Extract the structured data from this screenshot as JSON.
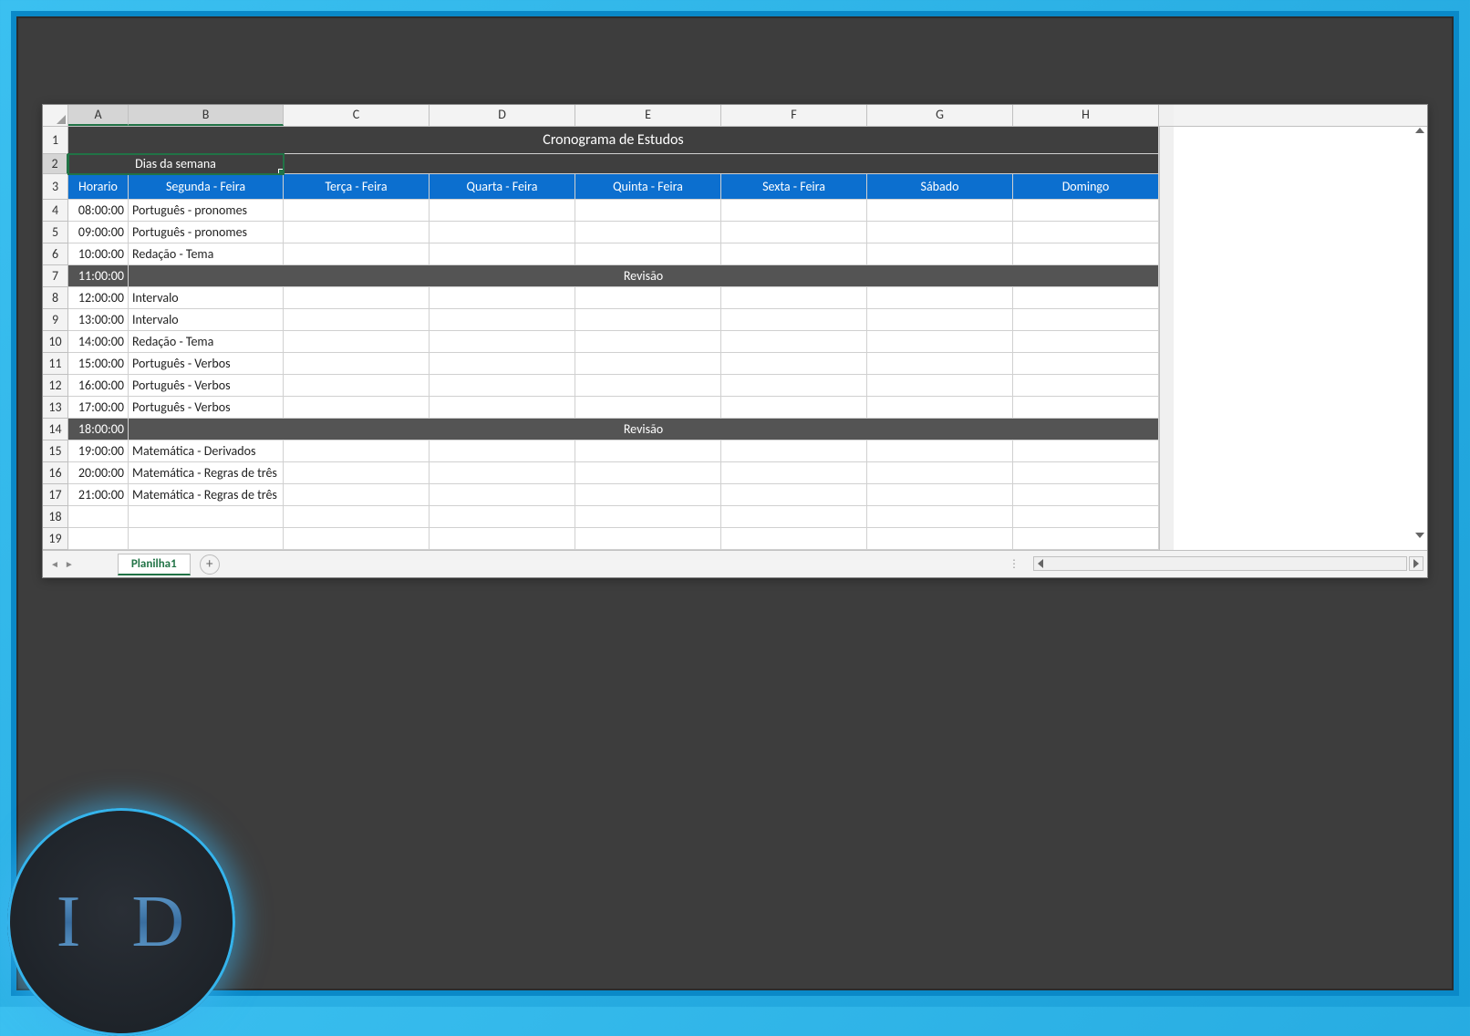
{
  "logo_text": "I D",
  "sheet": {
    "columns": [
      "A",
      "B",
      "C",
      "D",
      "E",
      "F",
      "G",
      "H"
    ],
    "title": "Cronograma de Estudos",
    "subheader": "Dias da semana",
    "day_headers": {
      "horario": "Horario",
      "segunda": "Segunda - Feira",
      "terca": "Terça  - Feira",
      "quarta": "Quarta - Feira",
      "quinta": "Quinta - Feira",
      "sexta": "Sexta - Feira",
      "sabado": "Sábado",
      "domingo": "Domingo"
    },
    "rows": [
      {
        "n": 4,
        "time": "08:00:00",
        "b": "Português - pronomes"
      },
      {
        "n": 5,
        "time": "09:00:00",
        "b": "Português - pronomes"
      },
      {
        "n": 6,
        "time": "10:00:00",
        "b": "Redação -  Tema"
      },
      {
        "n": 7,
        "time": "11:00:00",
        "revisao": "Revisão"
      },
      {
        "n": 8,
        "time": "12:00:00",
        "b": "Intervalo"
      },
      {
        "n": 9,
        "time": "13:00:00",
        "b": "Intervalo"
      },
      {
        "n": 10,
        "time": "14:00:00",
        "b": "Redação -  Tema"
      },
      {
        "n": 11,
        "time": "15:00:00",
        "b": "Português - Verbos"
      },
      {
        "n": 12,
        "time": "16:00:00",
        "b": "Português - Verbos"
      },
      {
        "n": 13,
        "time": "17:00:00",
        "b": "Português - Verbos"
      },
      {
        "n": 14,
        "time": "18:00:00",
        "revisao": "Revisão"
      },
      {
        "n": 15,
        "time": "19:00:00",
        "b": "Matemática - Derivados"
      },
      {
        "n": 16,
        "time": "20:00:00",
        "b": "Matemática - Regras de três"
      },
      {
        "n": 17,
        "time": "21:00:00",
        "b": "Matemática - Regras de três"
      },
      {
        "n": 18,
        "time": "",
        "b": ""
      },
      {
        "n": 19,
        "time": "",
        "b": ""
      }
    ],
    "tab_name": "Planilha1"
  }
}
